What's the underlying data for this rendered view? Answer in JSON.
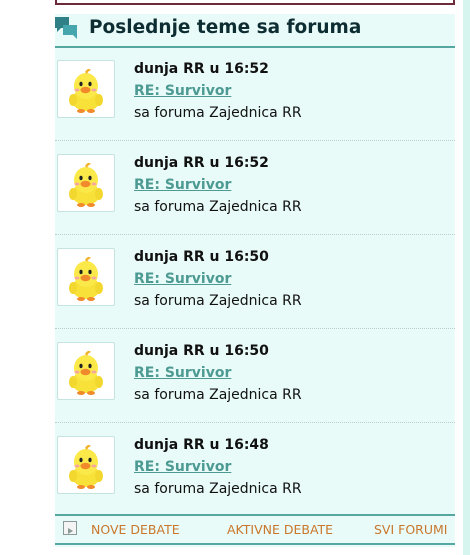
{
  "panel": {
    "title": "Poslednje teme sa foruma",
    "icon": "forum-chat-icon"
  },
  "posts": [
    {
      "author_time": "dunja RR u 16:52",
      "topic": "RE: Survivor",
      "forum": "sa foruma Zajednica RR",
      "avatar": "yellow-chick-avatar"
    },
    {
      "author_time": "dunja RR u 16:52",
      "topic": "RE: Survivor",
      "forum": "sa foruma Zajednica RR",
      "avatar": "yellow-chick-avatar"
    },
    {
      "author_time": "dunja RR u 16:50",
      "topic": "RE: Survivor",
      "forum": "sa foruma Zajednica RR",
      "avatar": "yellow-chick-avatar"
    },
    {
      "author_time": "dunja RR u 16:50",
      "topic": "RE: Survivor",
      "forum": "sa foruma Zajednica RR",
      "avatar": "yellow-chick-avatar"
    },
    {
      "author_time": "dunja RR u 16:48",
      "topic": "RE: Survivor",
      "forum": "sa foruma Zajednica RR",
      "avatar": "yellow-chick-avatar"
    }
  ],
  "footer": {
    "icon": "play-square-icon",
    "new_debates": "NOVE DEBATE",
    "active_debates": "AKTIVNE DEBATE",
    "all_forums": "SVI FORUMI"
  },
  "colors": {
    "panel_bg": "#e8fbf8",
    "accent_rule": "#55a7a0",
    "link": "#4d9a93",
    "footer_link": "#c9772c"
  }
}
